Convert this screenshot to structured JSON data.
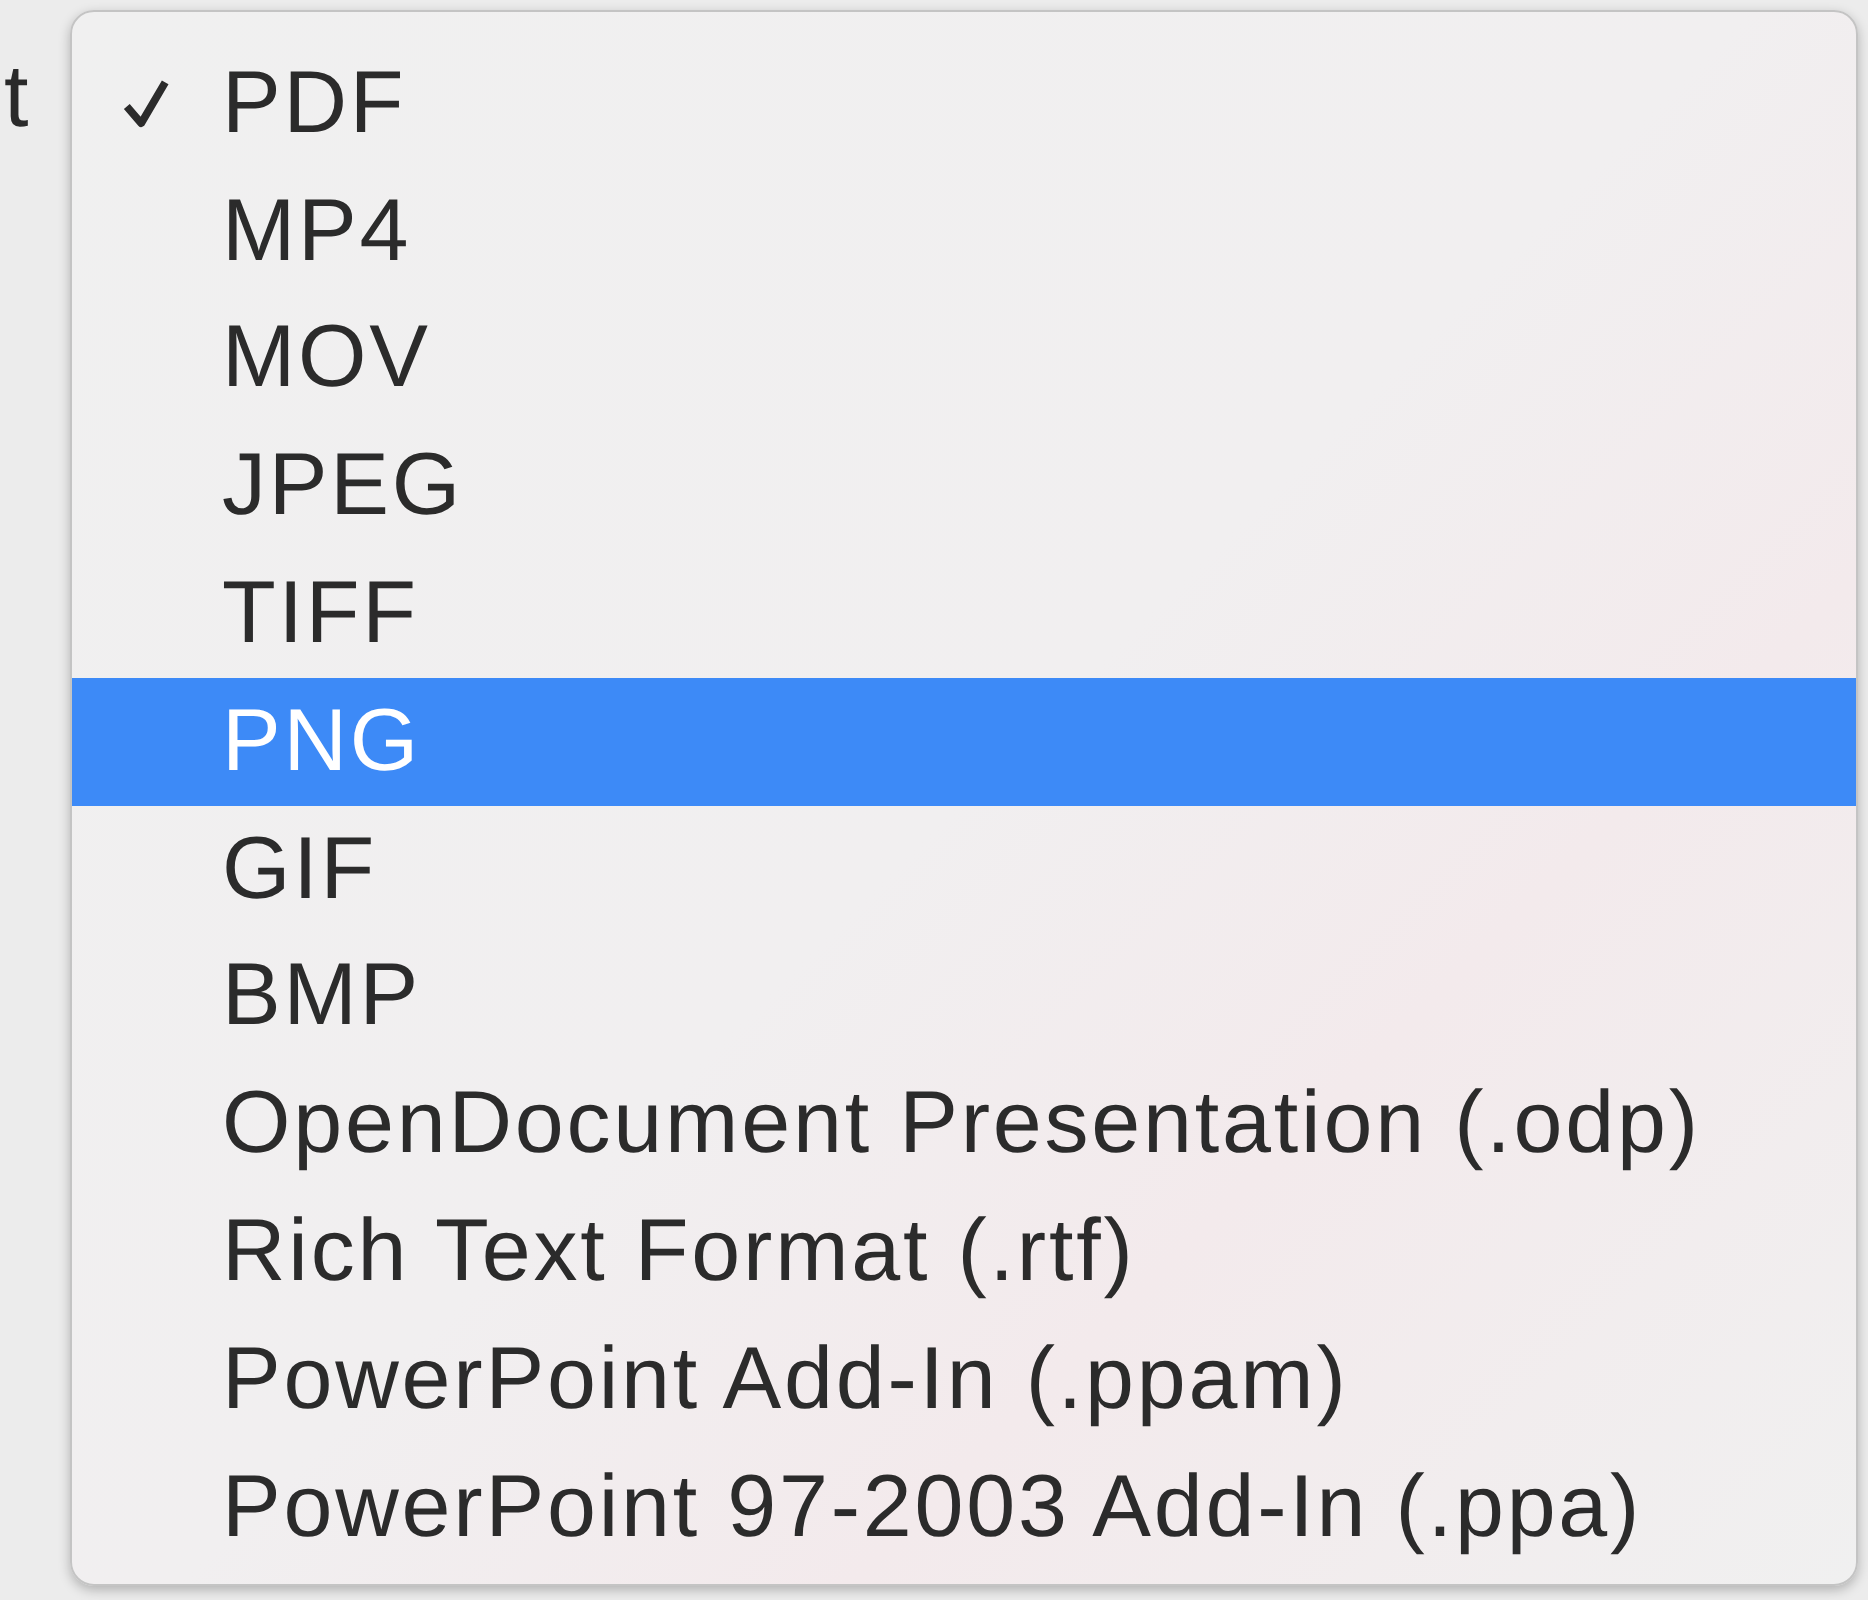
{
  "background_label": "t",
  "menu": {
    "items": [
      {
        "label": "PDF",
        "checked": true,
        "selected": false
      },
      {
        "label": "MP4",
        "checked": false,
        "selected": false
      },
      {
        "label": "MOV",
        "checked": false,
        "selected": false
      },
      {
        "label": "JPEG",
        "checked": false,
        "selected": false
      },
      {
        "label": "TIFF",
        "checked": false,
        "selected": false
      },
      {
        "label": "PNG",
        "checked": false,
        "selected": true
      },
      {
        "label": "GIF",
        "checked": false,
        "selected": false
      },
      {
        "label": "BMP",
        "checked": false,
        "selected": false
      },
      {
        "label": "OpenDocument Presentation (.odp)",
        "checked": false,
        "selected": false
      },
      {
        "label": "Rich Text Format (.rtf)",
        "checked": false,
        "selected": false
      },
      {
        "label": "PowerPoint Add-In (.ppam)",
        "checked": false,
        "selected": false
      },
      {
        "label": "PowerPoint 97-2003 Add-In (.ppa)",
        "checked": false,
        "selected": false
      }
    ]
  }
}
